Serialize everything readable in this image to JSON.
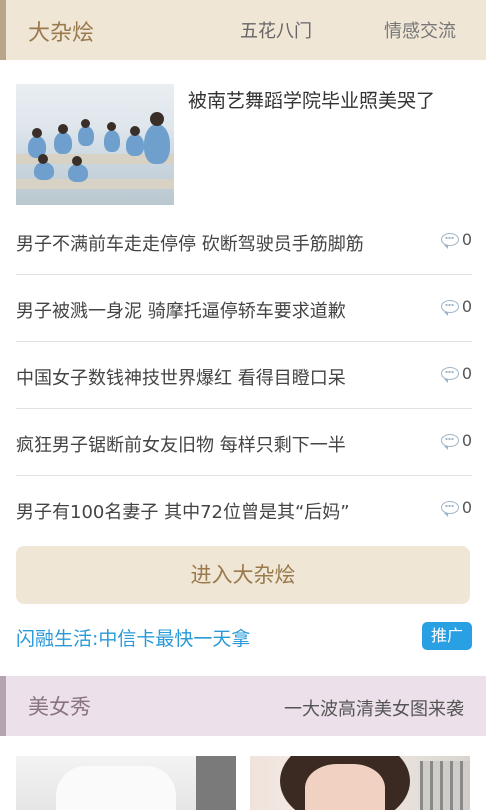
{
  "section1": {
    "title": "大杂烩",
    "tabs": [
      {
        "label": "五花八门"
      },
      {
        "label": "情感交流"
      }
    ]
  },
  "feature": {
    "title": "被南艺舞蹈学院毕业照美哭了"
  },
  "news": [
    {
      "title": "男子不满前车走走停停 砍断驾驶员手筋脚筋",
      "comments": "0"
    },
    {
      "title": "男子被溅一身泥 骑摩托逼停轿车要求道歉",
      "comments": "0"
    },
    {
      "title": "中国女子数钱神技世界爆红 看得目瞪口呆",
      "comments": "0"
    },
    {
      "title": "疯狂男子锯断前女友旧物 每样只剩下一半",
      "comments": "0"
    },
    {
      "title": "男子有100名妻子 其中72位曾是其“后妈”",
      "comments": "0"
    }
  ],
  "enter_button": "进入大杂烩",
  "promo": {
    "text": "闪融生活:中信卡最快一天拿",
    "badge": "推广"
  },
  "section2": {
    "title": "美女秀",
    "subtitle": "一大波高清美女图来袭"
  },
  "icons": {
    "comment": "comment-bubble-icon"
  },
  "colors": {
    "accent": "#9a7a4c",
    "link": "#2a9ad8",
    "badge": "#2aa0e4"
  }
}
